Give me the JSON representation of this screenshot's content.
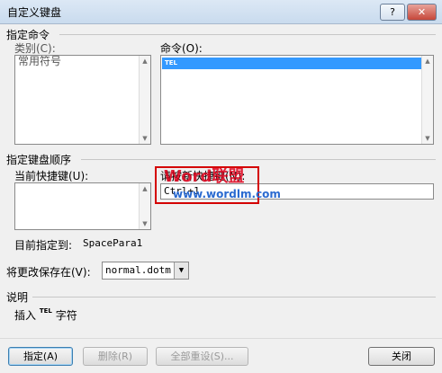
{
  "window": {
    "title": "自定义键盘",
    "help_glyph": "?",
    "close_glyph": "✕"
  },
  "specify_command": {
    "label": "指定命令",
    "categories_label": "类别(C):",
    "categories": [
      "常用符号"
    ],
    "commands_label": "命令(O):",
    "commands": [
      "TEL"
    ]
  },
  "key_sequence": {
    "label": "指定键盘顺序",
    "current_keys_label": "当前快捷键(U):",
    "current_keys": [],
    "new_key_label": "请按新快捷键(N):",
    "new_key_value": "Ctrl+1",
    "assigned_label": "目前指定到:",
    "assigned_value": "SpacePara1"
  },
  "save_in": {
    "label": "将更改保存在(V):",
    "value": "normal.dotm",
    "arrow": "▼"
  },
  "description": {
    "label": "说明",
    "text_prefix": "插入",
    "symbol": "TEL",
    "text_suffix": "字符"
  },
  "buttons": {
    "assign": "指定(A)",
    "remove": "删除(R)",
    "reset_all": "全部重设(S)...",
    "close": "关闭"
  },
  "watermark": {
    "brand_word": "Word",
    "brand_cn": "联盟",
    "url": "www.wordlm.com"
  },
  "scroll": {
    "up": "▲",
    "down": "▼"
  },
  "colors": {
    "selection": "#3399ff",
    "highlight_box": "#d40000",
    "watermark_red": "#e0001b",
    "watermark_blue": "#2a6ad0"
  }
}
